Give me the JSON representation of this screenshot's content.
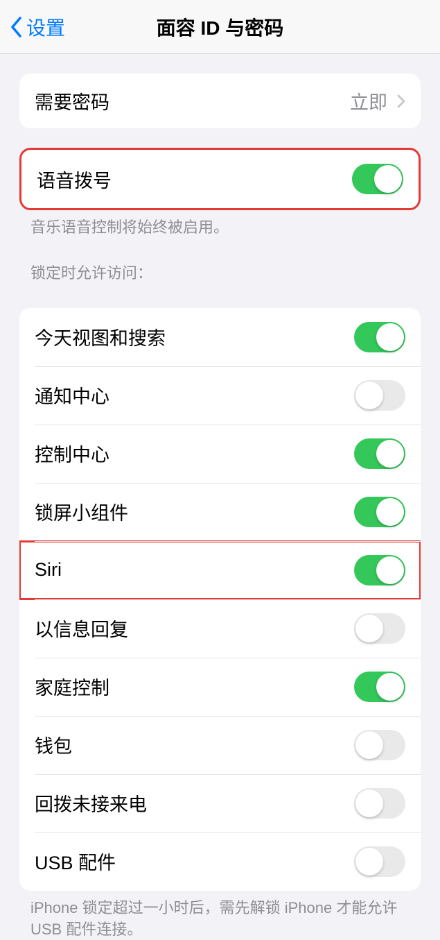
{
  "nav": {
    "back_label": "设置",
    "title": "面容 ID 与密码"
  },
  "require_passcode": {
    "label": "需要密码",
    "value": "立即"
  },
  "voice_dial": {
    "label": "语音拨号",
    "footer": "音乐语音控制将始终被启用。"
  },
  "lock_section": {
    "header": "锁定时允许访问：",
    "items": [
      {
        "label": "今天视图和搜索",
        "on": true
      },
      {
        "label": "通知中心",
        "on": false
      },
      {
        "label": "控制中心",
        "on": true
      },
      {
        "label": "锁屏小组件",
        "on": true
      },
      {
        "label": "Siri",
        "on": true
      },
      {
        "label": "以信息回复",
        "on": false
      },
      {
        "label": "家庭控制",
        "on": true
      },
      {
        "label": "钱包",
        "on": false
      },
      {
        "label": "回拨未接来电",
        "on": false
      },
      {
        "label": "USB 配件",
        "on": false
      }
    ],
    "footer": "iPhone 锁定超过一小时后，需先解锁 iPhone 才能允许 USB 配件连接。"
  }
}
